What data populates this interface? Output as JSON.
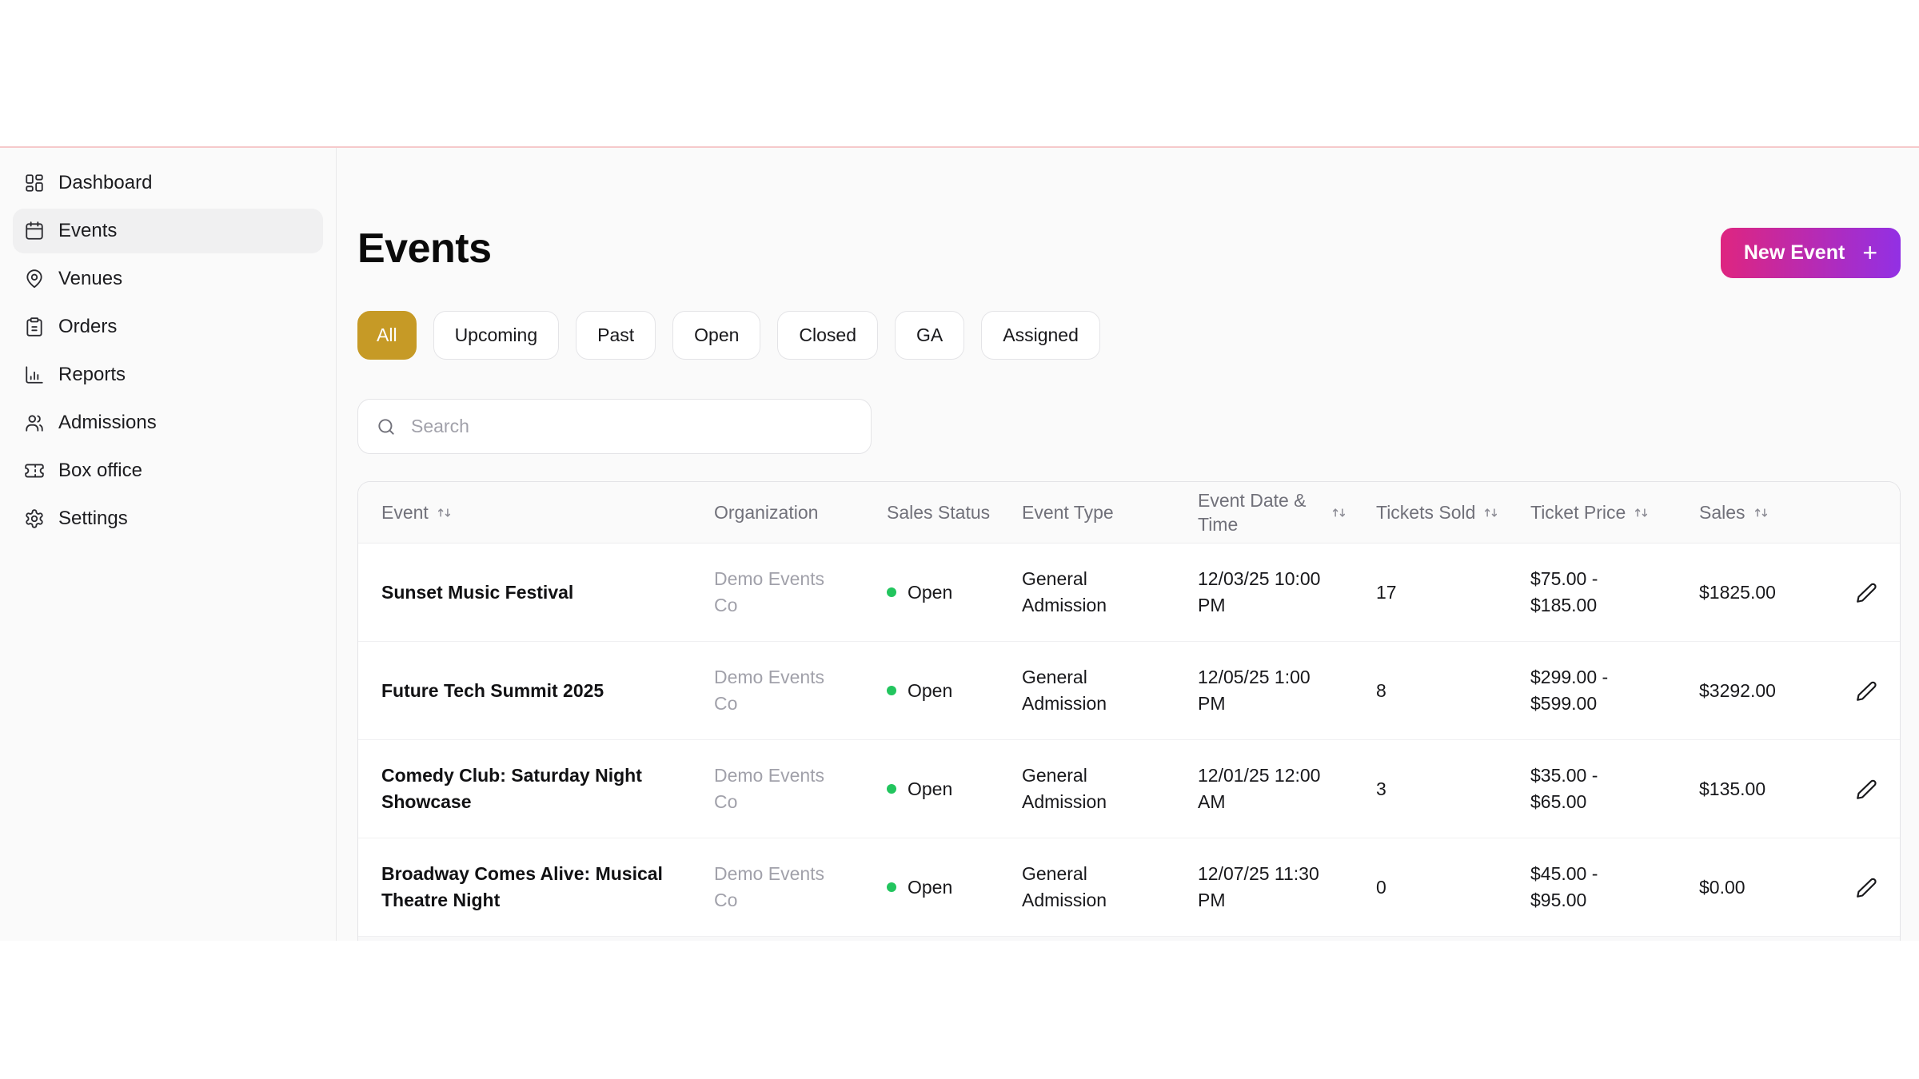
{
  "sidebar": {
    "items": [
      {
        "label": "Dashboard",
        "active": false
      },
      {
        "label": "Events",
        "active": true
      },
      {
        "label": "Venues",
        "active": false
      },
      {
        "label": "Orders",
        "active": false
      },
      {
        "label": "Reports",
        "active": false
      },
      {
        "label": "Admissions",
        "active": false
      },
      {
        "label": "Box office",
        "active": false
      },
      {
        "label": "Settings",
        "active": false
      }
    ]
  },
  "header": {
    "title": "Events",
    "new_event": {
      "label": "New Event",
      "plus": "+"
    }
  },
  "filters": {
    "chips": [
      {
        "label": "All",
        "active": true
      },
      {
        "label": "Upcoming",
        "active": false
      },
      {
        "label": "Past",
        "active": false
      },
      {
        "label": "Open",
        "active": false
      },
      {
        "label": "Closed",
        "active": false
      },
      {
        "label": "GA",
        "active": false
      },
      {
        "label": "Assigned",
        "active": false
      }
    ]
  },
  "search": {
    "placeholder": "Search",
    "value": ""
  },
  "table": {
    "columns": [
      {
        "label": "Event",
        "sortable": true
      },
      {
        "label": "Organization",
        "sortable": false
      },
      {
        "label": "Sales Status",
        "sortable": false
      },
      {
        "label": "Event Type",
        "sortable": false
      },
      {
        "label": "Event Date & Time",
        "sortable": true
      },
      {
        "label": "Tickets Sold",
        "sortable": true
      },
      {
        "label": "Ticket Price",
        "sortable": true
      },
      {
        "label": "Sales",
        "sortable": true
      }
    ],
    "rows": [
      {
        "event": "Sunset Music Festival",
        "organization": "Demo Events Co",
        "sales_status": "Open",
        "event_type": "General Admission",
        "event_datetime": "12/03/25 10:00 PM",
        "tickets_sold": "17",
        "ticket_price": "$75.00 - $185.00",
        "sales": "$1825.00"
      },
      {
        "event": "Future Tech Summit 2025",
        "organization": "Demo Events Co",
        "sales_status": "Open",
        "event_type": "General Admission",
        "event_datetime": "12/05/25 1:00 PM",
        "tickets_sold": "8",
        "ticket_price": "$299.00 - $599.00",
        "sales": "$3292.00"
      },
      {
        "event": "Comedy Club: Saturday Night Showcase",
        "organization": "Demo Events Co",
        "sales_status": "Open",
        "event_type": "General Admission",
        "event_datetime": "12/01/25 12:00 AM",
        "tickets_sold": "3",
        "ticket_price": "$35.00 - $65.00",
        "sales": "$135.00"
      },
      {
        "event": "Broadway Comes Alive: Musical Theatre Night",
        "organization": "Demo Events Co",
        "sales_status": "Open",
        "event_type": "General Admission",
        "event_datetime": "12/07/25 11:30 PM",
        "tickets_sold": "0",
        "ticket_price": "$45.00 - $95.00",
        "sales": "$0.00"
      }
    ]
  },
  "colors": {
    "accent_pink": "#DE2580",
    "accent_purple": "#9230E4",
    "filter_active_gold": "#C69A26",
    "status_open_green": "#22C55E",
    "top_divider_pink": "#F6C9CB"
  }
}
